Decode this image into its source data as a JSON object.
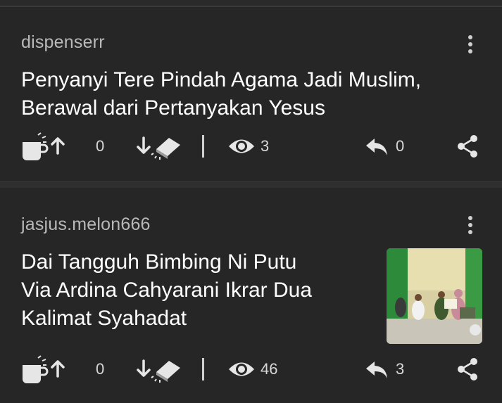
{
  "posts": [
    {
      "username": "dispenserr",
      "title_line1": "Penyanyi Tere Pindah Agama Jadi Muslim,",
      "title_line2": "Berawal dari Pertanyakan Yesus",
      "upvotes": "0",
      "views": "3",
      "replies": "0"
    },
    {
      "username": "jasjus.melon666",
      "title_line1": "Dai Tangguh Bimbing Ni Putu",
      "title_line2": "Via Ardina Cahyarani Ikrar Dua",
      "title_line3": "Kalimat Syahadat",
      "upvotes": "0",
      "views": "46",
      "replies": "3",
      "thumbnail": "photo of people seated in a green room"
    }
  ],
  "colors": {
    "background": "#262626",
    "text": "#ffffff",
    "muted": "#b9b9b9",
    "icon": "#d0d0d0"
  },
  "icons": [
    "more-vert-icon",
    "coffee-cup-icon",
    "arrow-up-icon",
    "arrow-down-icon",
    "eraser-icon",
    "eye-icon",
    "reply-icon",
    "share-icon"
  ]
}
